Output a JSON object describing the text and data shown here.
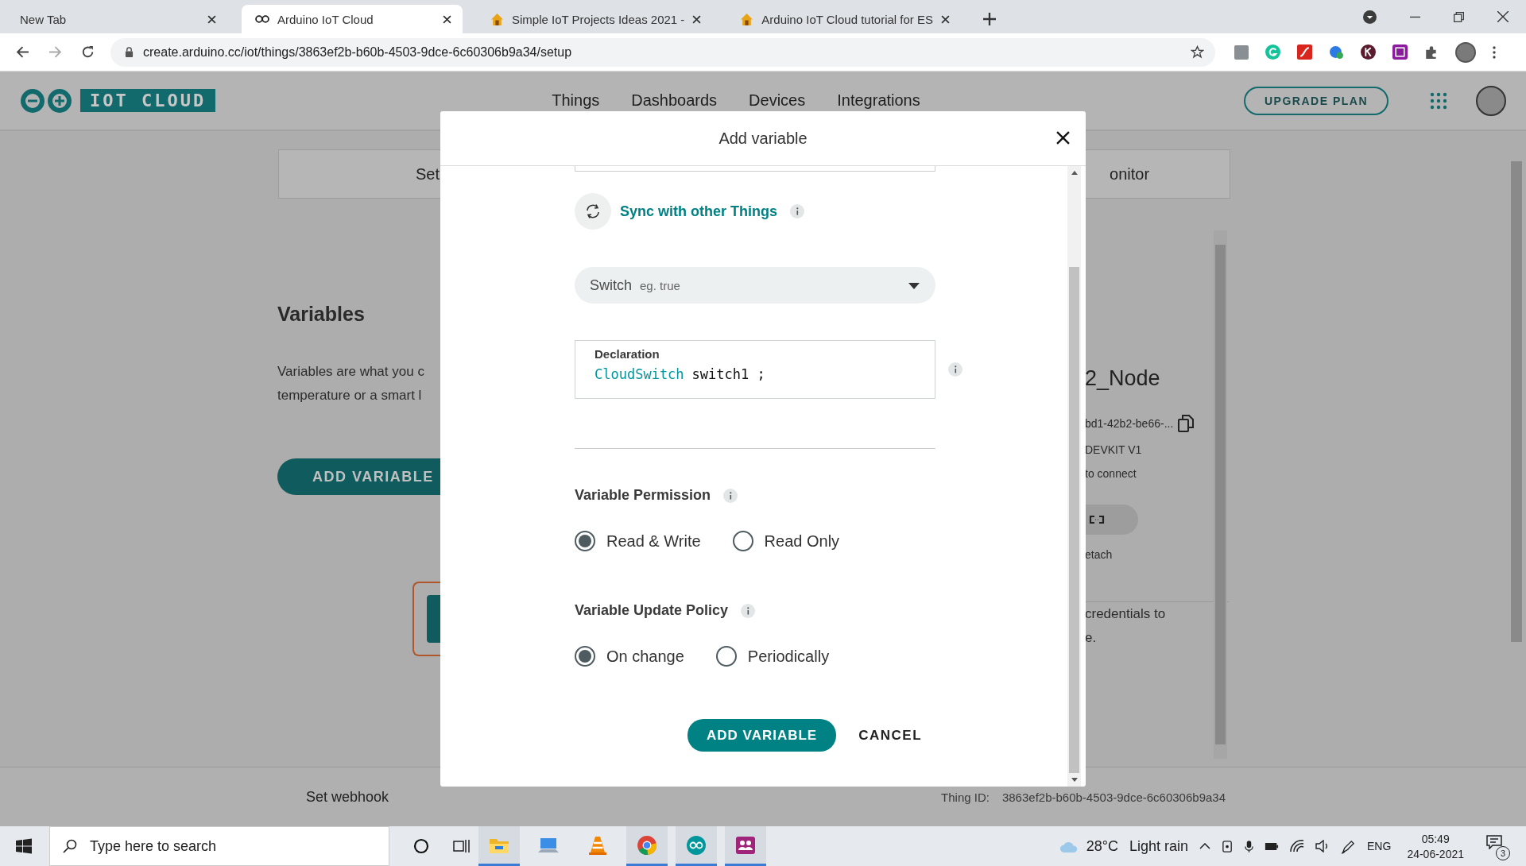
{
  "browser": {
    "tabs": [
      {
        "title": "New Tab",
        "selected": false
      },
      {
        "title": "Arduino IoT Cloud",
        "selected": true
      },
      {
        "title": "Simple IoT Projects Ideas 2021 -",
        "selected": false
      },
      {
        "title": "Arduino IoT Cloud tutorial for ES",
        "selected": false
      }
    ],
    "address": "create.arduino.cc/iot/things/3863ef2b-b60b-4503-9dce-6c60306b9a34/setup"
  },
  "app_header": {
    "logo_text": "IOT CLOUD",
    "nav": [
      "Things",
      "Dashboards",
      "Devices",
      "Integrations"
    ],
    "upgrade_button": "UPGRADE PLAN"
  },
  "page_tabs": [
    "Set",
    "onitor"
  ],
  "variables_section": {
    "heading": "Variables",
    "description_lines": [
      "Variables are what you c",
      "temperature or a smart l"
    ],
    "add_button": "ADD VARIABLE"
  },
  "device_panel": {
    "name": "2_Node",
    "id": "bd1-42b2-be66-...",
    "board": "DEVKIT V1",
    "status": "to connect",
    "detach_label": "etach",
    "network_lines": [
      "credentials to",
      "e."
    ]
  },
  "footer": {
    "webhook": "Set webhook",
    "thing_id_label": "Thing ID:",
    "thing_id": "3863ef2b-b60b-4503-9dce-6c60306b9a34"
  },
  "dialog": {
    "title": "Add variable",
    "sync_label": "Sync with other Things",
    "type": {
      "value": "Switch",
      "example": "eg. true"
    },
    "declaration": {
      "label": "Declaration",
      "type": "CloudSwitch",
      "name": "switch1 ;"
    },
    "groups": [
      {
        "label": "Variable Permission",
        "options": [
          {
            "label": "Read & Write",
            "selected": true
          },
          {
            "label": "Read Only",
            "selected": false
          }
        ]
      },
      {
        "label": "Variable Update Policy",
        "options": [
          {
            "label": "On change",
            "selected": true
          },
          {
            "label": "Periodically",
            "selected": false
          }
        ]
      }
    ],
    "buttons": [
      {
        "label": "ADD VARIABLE",
        "kind": "primary"
      },
      {
        "label": "CANCEL",
        "kind": "text"
      }
    ]
  },
  "taskbar": {
    "search_placeholder": "Type here to search",
    "apps": [
      {
        "kind": "explorer",
        "running": true
      },
      {
        "kind": "computer",
        "running": false
      },
      {
        "kind": "vlc",
        "running": false
      },
      {
        "kind": "chrome",
        "running": true
      },
      {
        "kind": "arduino",
        "running": true
      },
      {
        "kind": "teams",
        "running": true
      }
    ],
    "temperature": "28°C",
    "weather": "Light rain",
    "language": "ENG",
    "time": "05:49",
    "date": "24-06-2021",
    "notifications": "3"
  }
}
